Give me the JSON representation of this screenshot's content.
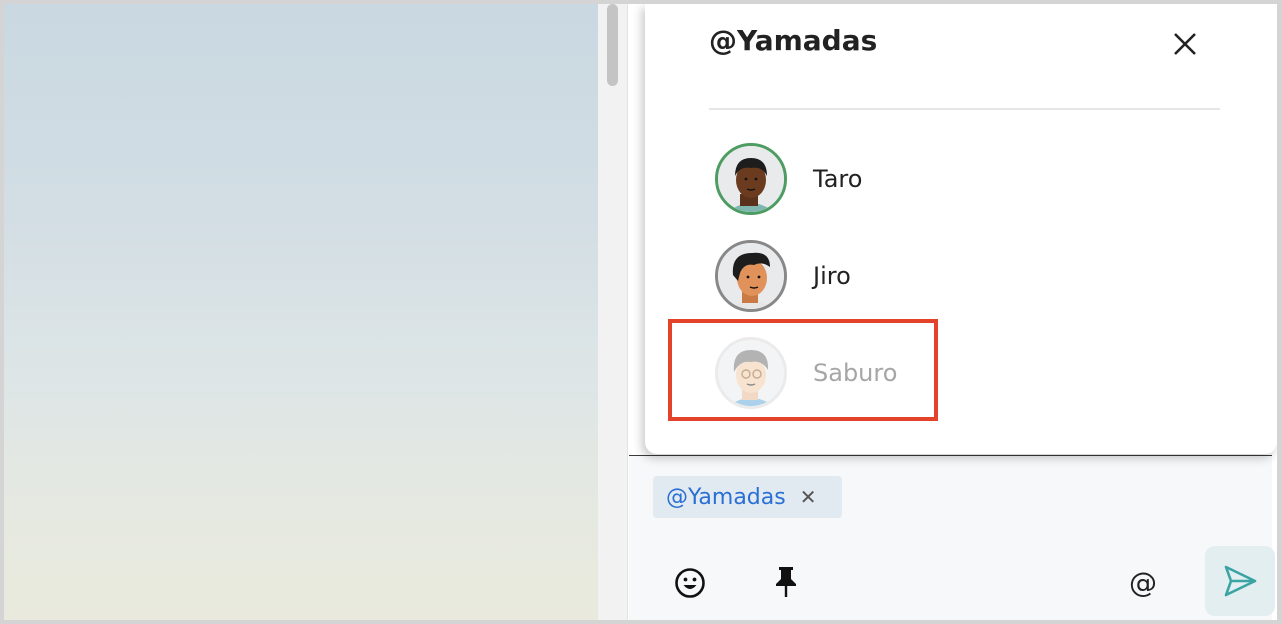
{
  "popup": {
    "title": "@Yamadas",
    "members": [
      {
        "name": "Taro",
        "status": "online",
        "skin": "#6b3b1f",
        "hair": "#1d1d1d"
      },
      {
        "name": "Jiro",
        "status": "offline",
        "skin": "#e0925a",
        "hair": "#1d1d1d"
      },
      {
        "name": "Saburo",
        "status": "disabled",
        "skin": "#f3c9a2",
        "hair": "#6a6a6a"
      }
    ]
  },
  "composer": {
    "mention_chip": "@Yamadas",
    "at_label": "@"
  },
  "colors": {
    "mention": "#2a6fd3",
    "online": "#4d9c62",
    "highlight": "#e2432a",
    "send": "#3aa3a3"
  },
  "icons": [
    "close-icon",
    "remove-icon",
    "emoji-icon",
    "pin-icon",
    "send-icon"
  ]
}
